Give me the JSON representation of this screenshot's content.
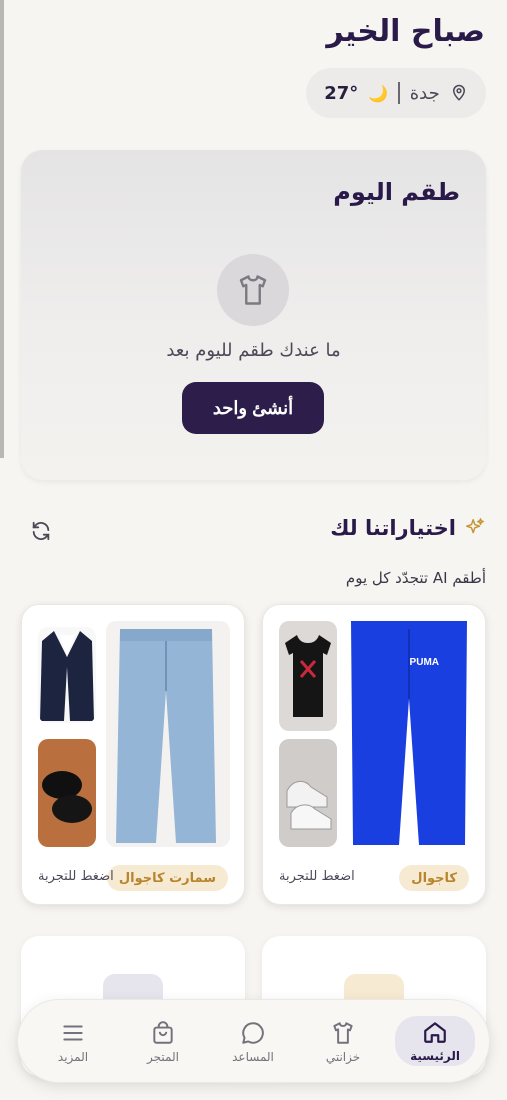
{
  "greeting": "صباح الخير",
  "weather": {
    "location": "جدة",
    "temperature": "27°",
    "condition_icon": "moon-icon"
  },
  "today_outfit": {
    "title": "طقم اليوم",
    "empty_message": "ما عندك طقم لليوم بعد",
    "create_button": "أنشئ واحد",
    "icon": "tshirt-icon"
  },
  "picks": {
    "title": "اختياراتنا لك",
    "subtitle": "أطقم AI تتجدّد كل يوم",
    "cards": [
      {
        "tag": "كاجوال",
        "action": "اضغط للتجربة",
        "items": [
          "blue-track-pants",
          "black-tshirt",
          "white-sneakers"
        ]
      },
      {
        "tag": "سمارت كاجوال",
        "action": "اضغط للتجربة",
        "items": [
          "light-blue-jeans",
          "navy-blazer",
          "black-loafers"
        ]
      }
    ]
  },
  "nav": {
    "items": [
      {
        "label": "الرئيسية",
        "icon": "home-icon",
        "active": true
      },
      {
        "label": "خزانتي",
        "icon": "tshirt-icon",
        "active": false
      },
      {
        "label": "المساعد",
        "icon": "chat-icon",
        "active": false
      },
      {
        "label": "المتجر",
        "icon": "shopping-bag-icon",
        "active": false
      },
      {
        "label": "المزيد",
        "icon": "menu-icon",
        "active": false
      }
    ]
  },
  "colors": {
    "background": "#f7f5f1",
    "primary": "#2c1d4a",
    "tag_bg": "#f6ead3",
    "tag_text": "#b8842c",
    "accent_gold": "#f0b429"
  }
}
